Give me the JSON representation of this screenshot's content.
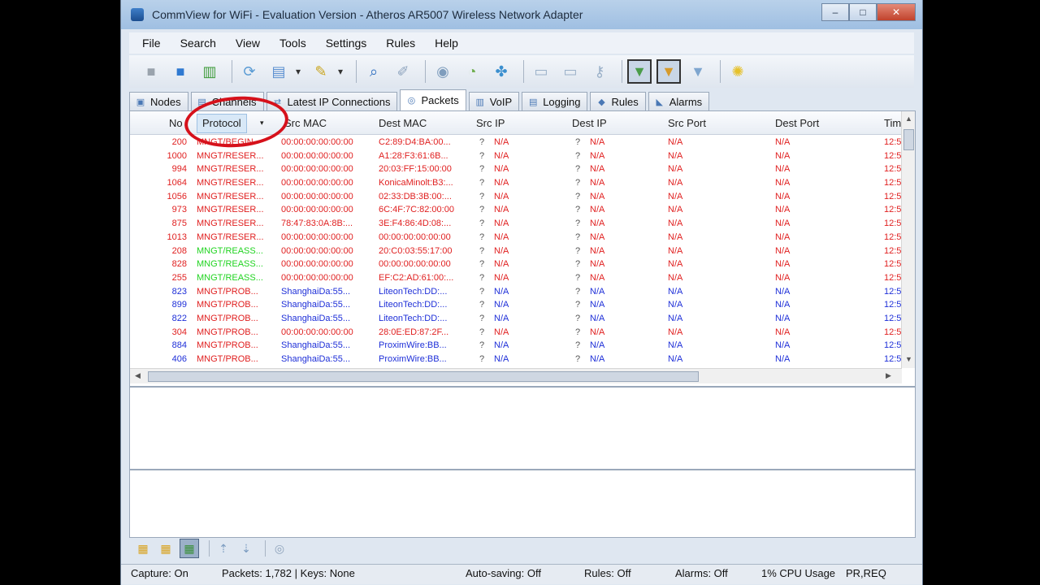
{
  "window": {
    "title": "CommView for WiFi - Evaluation Version - Atheros AR5007 Wireless Network Adapter",
    "controls": {
      "minimize": "–",
      "maximize": "□",
      "close": "✕"
    }
  },
  "menu": [
    "File",
    "Search",
    "View",
    "Tools",
    "Settings",
    "Rules",
    "Help"
  ],
  "toolbar": {
    "buttons": [
      {
        "name": "stop-capture-icon",
        "glyph": "■",
        "color": "#9aa3ad"
      },
      {
        "name": "start-capture-icon",
        "glyph": "■",
        "color": "#2f79d1"
      },
      {
        "name": "open-logs-icon",
        "glyph": "▥",
        "color": "#3e9b3a"
      },
      {
        "name": "reconstruct-icon",
        "glyph": "⟳",
        "color": "#5a9bd4"
      },
      {
        "name": "save-icon",
        "glyph": "▤",
        "color": "#5a8fd0"
      },
      {
        "name": "dropdown-icon",
        "glyph": "▾",
        "color": "#333"
      },
      {
        "name": "filter-icon",
        "glyph": "✎",
        "color": "#c9a41c"
      },
      {
        "name": "dropdown-icon-2",
        "glyph": "▾",
        "color": "#333"
      },
      {
        "name": "search-icon",
        "glyph": "⌕",
        "color": "#2f6fc0"
      },
      {
        "name": "wand-icon",
        "glyph": "✐",
        "color": "#8da3bd"
      },
      {
        "name": "nodes-icon",
        "glyph": "◉",
        "color": "#7f9dbd"
      },
      {
        "name": "chart-icon",
        "glyph": "◔",
        "color": "#6fae4f"
      },
      {
        "name": "network-icon",
        "glyph": "✤",
        "color": "#3b8fcf"
      },
      {
        "name": "monitor-icon",
        "glyph": "▭",
        "color": "#9ab0c8"
      },
      {
        "name": "monitor-alt-icon",
        "glyph": "▭",
        "color": "#9ab0c8"
      },
      {
        "name": "key-icon",
        "glyph": "⚷",
        "color": "#9ab0c8"
      },
      {
        "name": "packet-generator-icon",
        "glyph": "▼",
        "color": "#4a9c49",
        "pressed": true
      },
      {
        "name": "packet-generator-alt-icon",
        "glyph": "▼",
        "color": "#d69a2b",
        "pressed": true
      },
      {
        "name": "arrow-down-icon",
        "glyph": "▼",
        "color": "#7fa6cf"
      },
      {
        "name": "bulb-icon",
        "glyph": "✺",
        "color": "#e6c12b"
      }
    ]
  },
  "tabs": [
    {
      "label": "Nodes",
      "icon": "▣",
      "active": false
    },
    {
      "label": "Channels",
      "icon": "▤",
      "active": false
    },
    {
      "label": "Latest IP Connections",
      "icon": "⇄",
      "active": false
    },
    {
      "label": "Packets",
      "icon": "◎",
      "active": true
    },
    {
      "label": "VoIP",
      "icon": "▥",
      "active": false
    },
    {
      "label": "Logging",
      "icon": "▤",
      "active": false
    },
    {
      "label": "Rules",
      "icon": "◆",
      "active": false
    },
    {
      "label": "Alarms",
      "icon": "◣",
      "active": false
    }
  ],
  "columns": [
    "No",
    "Protocol",
    "Src MAC",
    "Dest MAC",
    "Src IP",
    "Dest IP",
    "Src Port",
    "Dest Port",
    "Tim"
  ],
  "rows": [
    {
      "no": "200",
      "protocol": "MNGT/BEGIN",
      "src_mac": "00:00:00:00:00:00",
      "dest_mac": "C2:89:D4:BA:00...",
      "src_ip": "N/A",
      "dest_ip": "N/A",
      "src_port": "N/A",
      "dest_port": "N/A",
      "time": "12:5",
      "color": "#e02020"
    },
    {
      "no": "1000",
      "protocol": "MNGT/RESER...",
      "src_mac": "00:00:00:00:00:00",
      "dest_mac": "A1:28:F3:61:6B...",
      "src_ip": "N/A",
      "dest_ip": "N/A",
      "src_port": "N/A",
      "dest_port": "N/A",
      "time": "12:5",
      "color": "#e02020"
    },
    {
      "no": "994",
      "protocol": "MNGT/RESER...",
      "src_mac": "00:00:00:00:00:00",
      "dest_mac": "20:03:FF:15:00:00",
      "src_ip": "N/A",
      "dest_ip": "N/A",
      "src_port": "N/A",
      "dest_port": "N/A",
      "time": "12:5",
      "color": "#e02020"
    },
    {
      "no": "1064",
      "protocol": "MNGT/RESER...",
      "src_mac": "00:00:00:00:00:00",
      "dest_mac": "KonicaMinolt:B3:...",
      "src_ip": "N/A",
      "dest_ip": "N/A",
      "src_port": "N/A",
      "dest_port": "N/A",
      "time": "12:5",
      "color": "#e02020"
    },
    {
      "no": "1056",
      "protocol": "MNGT/RESER...",
      "src_mac": "00:00:00:00:00:00",
      "dest_mac": "02:33:DB:3B:00:...",
      "src_ip": "N/A",
      "dest_ip": "N/A",
      "src_port": "N/A",
      "dest_port": "N/A",
      "time": "12:5",
      "color": "#e02020"
    },
    {
      "no": "973",
      "protocol": "MNGT/RESER...",
      "src_mac": "00:00:00:00:00:00",
      "dest_mac": "6C:4F:7C:82:00:00",
      "src_ip": "N/A",
      "dest_ip": "N/A",
      "src_port": "N/A",
      "dest_port": "N/A",
      "time": "12:5",
      "color": "#e02020"
    },
    {
      "no": "875",
      "protocol": "MNGT/RESER...",
      "src_mac": "78:47:83:0A:8B:...",
      "dest_mac": "3E:F4:86:4D:08:...",
      "src_ip": "N/A",
      "dest_ip": "N/A",
      "src_port": "N/A",
      "dest_port": "N/A",
      "time": "12:5",
      "color": "#e02020"
    },
    {
      "no": "1013",
      "protocol": "MNGT/RESER...",
      "src_mac": "00:00:00:00:00:00",
      "dest_mac": "00:00:00:00:00:00",
      "src_ip": "N/A",
      "dest_ip": "N/A",
      "src_port": "N/A",
      "dest_port": "N/A",
      "time": "12:5",
      "color": "#e02020"
    },
    {
      "no": "208",
      "protocol": "MNGT/REASS...",
      "src_mac": "00:00:00:00:00:00",
      "dest_mac": "20:C0:03:55:17:00",
      "src_ip": "N/A",
      "dest_ip": "N/A",
      "src_port": "N/A",
      "dest_port": "N/A",
      "time": "12:5",
      "color": "#e02020",
      "protocol_color": "#21d421"
    },
    {
      "no": "828",
      "protocol": "MNGT/REASS...",
      "src_mac": "00:00:00:00:00:00",
      "dest_mac": "00:00:00:00:00:00",
      "src_ip": "N/A",
      "dest_ip": "N/A",
      "src_port": "N/A",
      "dest_port": "N/A",
      "time": "12:5",
      "color": "#e02020",
      "protocol_color": "#21d421"
    },
    {
      "no": "255",
      "protocol": "MNGT/REASS...",
      "src_mac": "00:00:00:00:00:00",
      "dest_mac": "EF:C2:AD:61:00:...",
      "src_ip": "N/A",
      "dest_ip": "N/A",
      "src_port": "N/A",
      "dest_port": "N/A",
      "time": "12:5",
      "color": "#e02020",
      "protocol_color": "#21d421"
    },
    {
      "no": "823",
      "protocol": "MNGT/PROB...",
      "src_mac": "ShanghaiDa:55...",
      "dest_mac": "LiteonTech:DD:...",
      "src_ip": "N/A",
      "dest_ip": "N/A",
      "src_port": "N/A",
      "dest_port": "N/A",
      "time": "12:5",
      "color": "#1e2fd8",
      "protocol_color": "#e02020"
    },
    {
      "no": "899",
      "protocol": "MNGT/PROB...",
      "src_mac": "ShanghaiDa:55...",
      "dest_mac": "LiteonTech:DD:...",
      "src_ip": "N/A",
      "dest_ip": "N/A",
      "src_port": "N/A",
      "dest_port": "N/A",
      "time": "12:5",
      "color": "#1e2fd8",
      "protocol_color": "#e02020"
    },
    {
      "no": "822",
      "protocol": "MNGT/PROB...",
      "src_mac": "ShanghaiDa:55...",
      "dest_mac": "LiteonTech:DD:...",
      "src_ip": "N/A",
      "dest_ip": "N/A",
      "src_port": "N/A",
      "dest_port": "N/A",
      "time": "12:5",
      "color": "#1e2fd8",
      "protocol_color": "#e02020"
    },
    {
      "no": "304",
      "protocol": "MNGT/PROB...",
      "src_mac": "00:00:00:00:00:00",
      "dest_mac": "28:0E:ED:87:2F...",
      "src_ip": "N/A",
      "dest_ip": "N/A",
      "src_port": "N/A",
      "dest_port": "N/A",
      "time": "12:5",
      "color": "#e02020"
    },
    {
      "no": "884",
      "protocol": "MNGT/PROB...",
      "src_mac": "ShanghaiDa:55...",
      "dest_mac": "ProximWire:BB...",
      "src_ip": "N/A",
      "dest_ip": "N/A",
      "src_port": "N/A",
      "dest_port": "N/A",
      "time": "12:5",
      "color": "#1e2fd8",
      "protocol_color": "#e02020"
    },
    {
      "no": "406",
      "protocol": "MNGT/PROB...",
      "src_mac": "ShanghaiDa:55...",
      "dest_mac": "ProximWire:BB...",
      "src_ip": "N/A",
      "dest_ip": "N/A",
      "src_port": "N/A",
      "dest_port": "N/A",
      "time": "12:5",
      "color": "#1e2fd8",
      "protocol_color": "#e02020"
    }
  ],
  "ip_prefix": "?",
  "bottom_buttons": [
    {
      "name": "folder-icon",
      "glyph": "▦",
      "color": "#d9a21d"
    },
    {
      "name": "folder-alt-icon",
      "glyph": "▦",
      "color": "#d9a21d"
    },
    {
      "name": "grid-view-icon",
      "glyph": "▦",
      "color": "#3a8f3a",
      "pressed": true
    },
    {
      "name": "export-icon",
      "glyph": "⇡",
      "color": "#7a9bc0"
    },
    {
      "name": "import-icon",
      "glyph": "⇣",
      "color": "#7a9bc0"
    },
    {
      "name": "packets-icon",
      "glyph": "◎",
      "color": "#8ea3bb"
    }
  ],
  "status": {
    "capture": "Capture: On",
    "packets": "Packets: 1,782 | Keys: None",
    "autosaving": "Auto-saving: Off",
    "rules": "Rules: Off",
    "alarms": "Alarms: Off",
    "cpu": "1% CPU Usage",
    "mode": "PR,REQ"
  },
  "colors": {
    "highlight_circle": "#d6111b",
    "red_text": "#e02020",
    "blue_text": "#1e2fd8",
    "green_text": "#21d421"
  }
}
